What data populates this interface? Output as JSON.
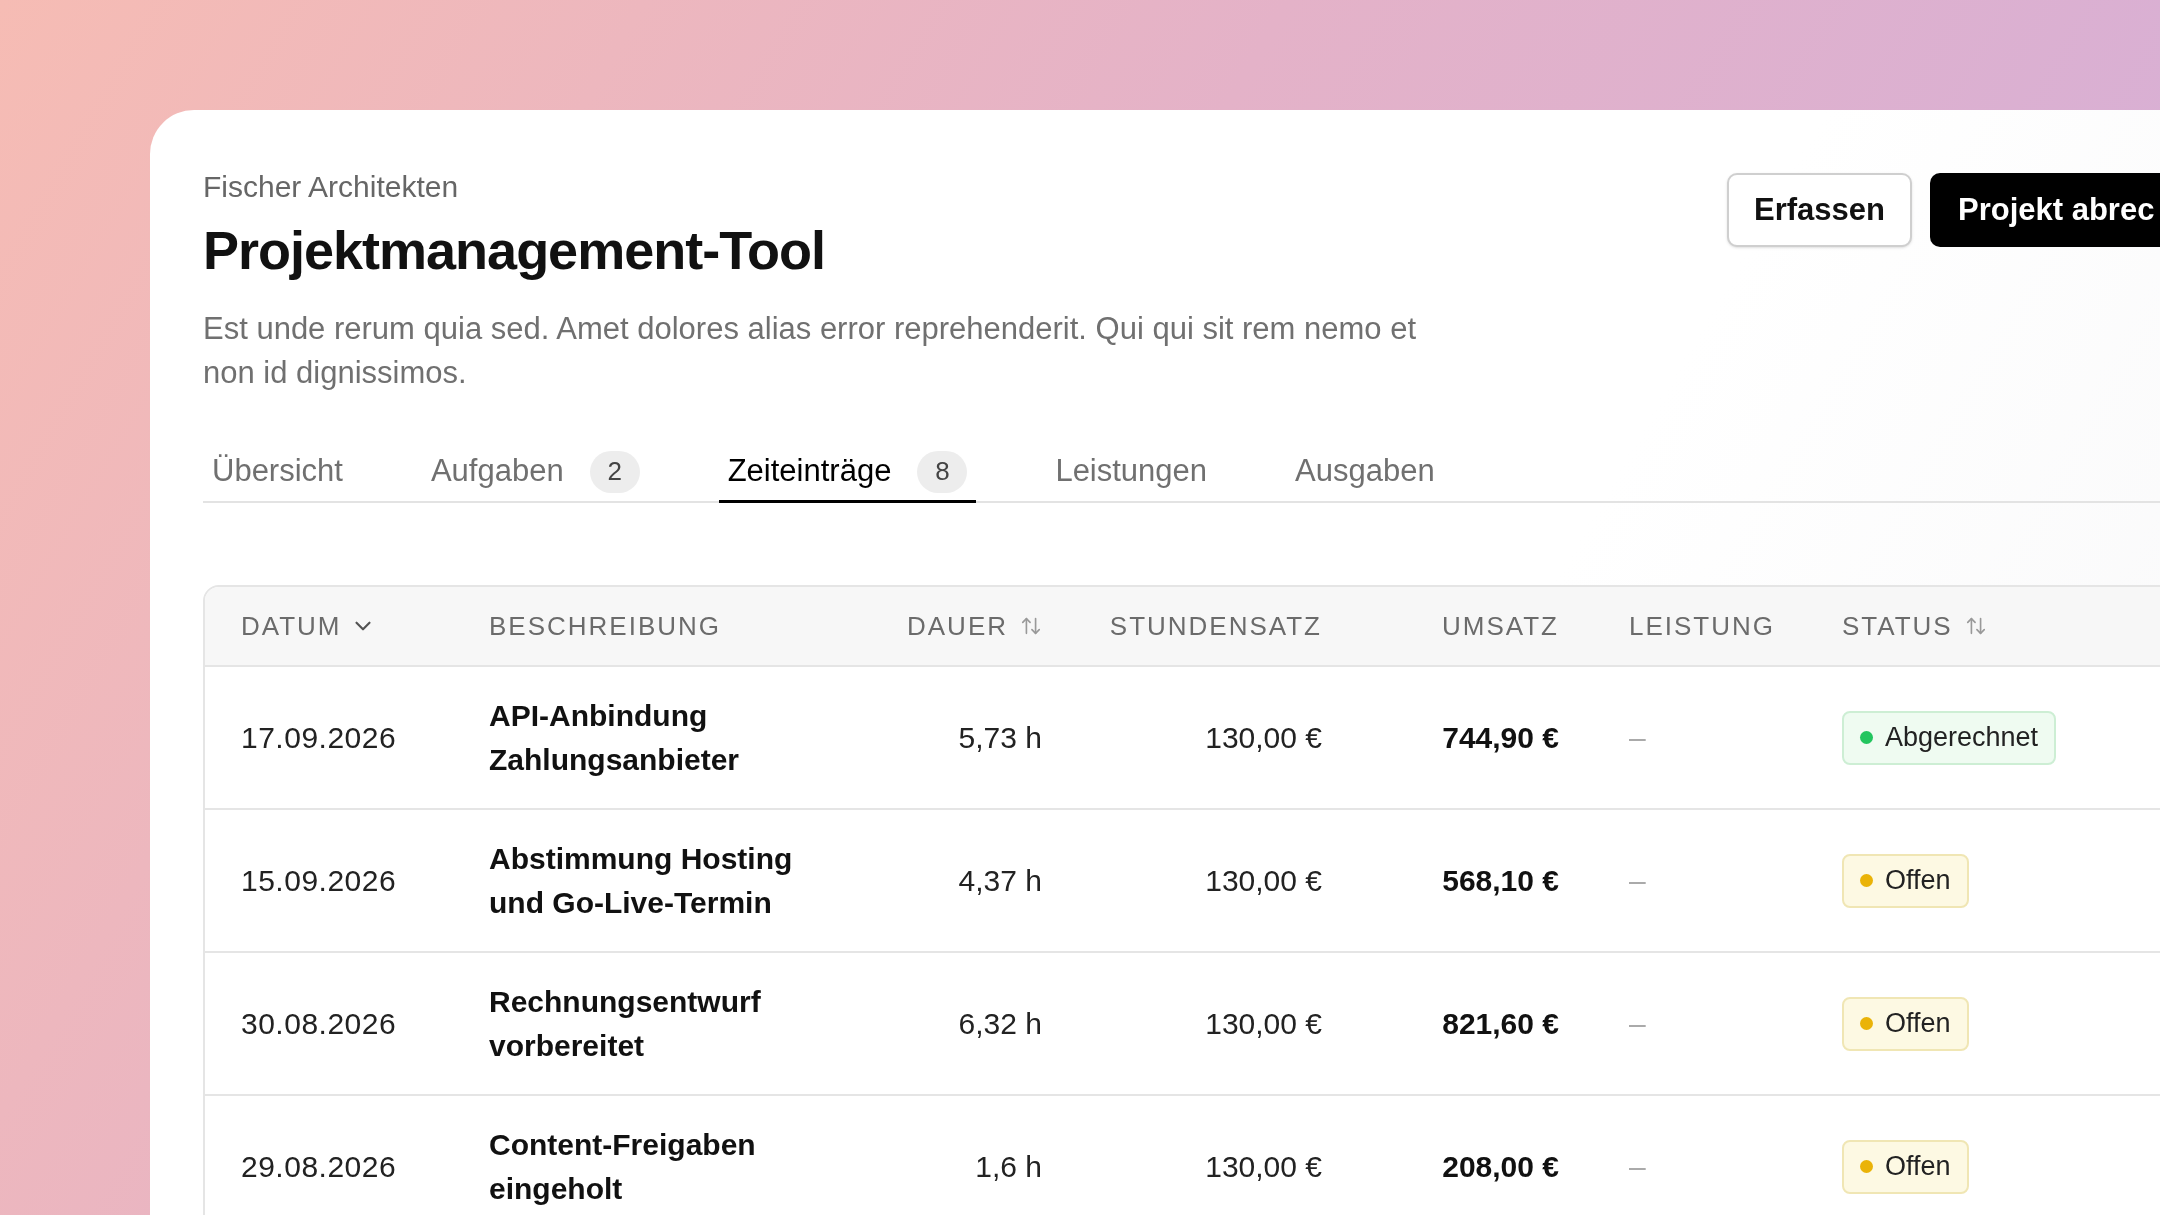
{
  "header": {
    "client": "Fischer Architekten",
    "title": "Projektmanagement-Tool",
    "description": "Est unde rerum quia sed. Amet dolores alias error reprehenderit. Qui qui sit rem nemo et non id dignissimos."
  },
  "actions": [
    {
      "label": "Erfassen",
      "kind": "secondary"
    },
    {
      "label": "Projekt abrec",
      "kind": "primary"
    }
  ],
  "tabs": [
    {
      "label": "Übersicht",
      "selected": false
    },
    {
      "label": "Aufgaben",
      "count": "2",
      "selected": false
    },
    {
      "label": "Zeiteinträge",
      "count": "8",
      "selected": true
    },
    {
      "label": "Leistungen",
      "selected": false
    },
    {
      "label": "Ausgaben",
      "selected": false
    }
  ],
  "table": {
    "columns": [
      {
        "label": "DATUM",
        "kind": "sorted"
      },
      {
        "label": "BESCHREIBUNG",
        "kind": "plain"
      },
      {
        "label": "DAUER",
        "kind": "sortable"
      },
      {
        "label": "STUNDENSATZ",
        "kind": "plain"
      },
      {
        "label": "UMSATZ",
        "kind": "plain"
      },
      {
        "label": "LEISTUNG",
        "kind": "plain"
      },
      {
        "label": "STATUS",
        "kind": "sortable"
      }
    ],
    "rows": [
      {
        "date": "17.09.2026",
        "description": "API-Anbindung Zahlungsanbieter",
        "duration": "5,73 h",
        "rate": "130,00 €",
        "revenue": "744,90 €",
        "service": "–",
        "status": {
          "label": "Abgerechnet",
          "kind": "billed",
          "color": "#22c55e"
        }
      },
      {
        "date": "15.09.2026",
        "description": "Abstimmung Hosting und Go-Live-Termin",
        "duration": "4,37 h",
        "rate": "130,00 €",
        "revenue": "568,10 €",
        "service": "–",
        "status": {
          "label": "Offen",
          "kind": "open",
          "color": "#eab308"
        }
      },
      {
        "date": "30.08.2026",
        "description": "Rechnungsentwurf vorbereitet",
        "duration": "6,32 h",
        "rate": "130,00 €",
        "revenue": "821,60 €",
        "service": "–",
        "status": {
          "label": "Offen",
          "kind": "open",
          "color": "#eab308"
        }
      },
      {
        "date": "29.08.2026",
        "description": "Content-Freigaben eingeholt",
        "duration": "1,6 h",
        "rate": "130,00 €",
        "revenue": "208,00 €",
        "service": "–",
        "status": {
          "label": "Offen",
          "kind": "open",
          "color": "#eab308"
        }
      }
    ]
  }
}
